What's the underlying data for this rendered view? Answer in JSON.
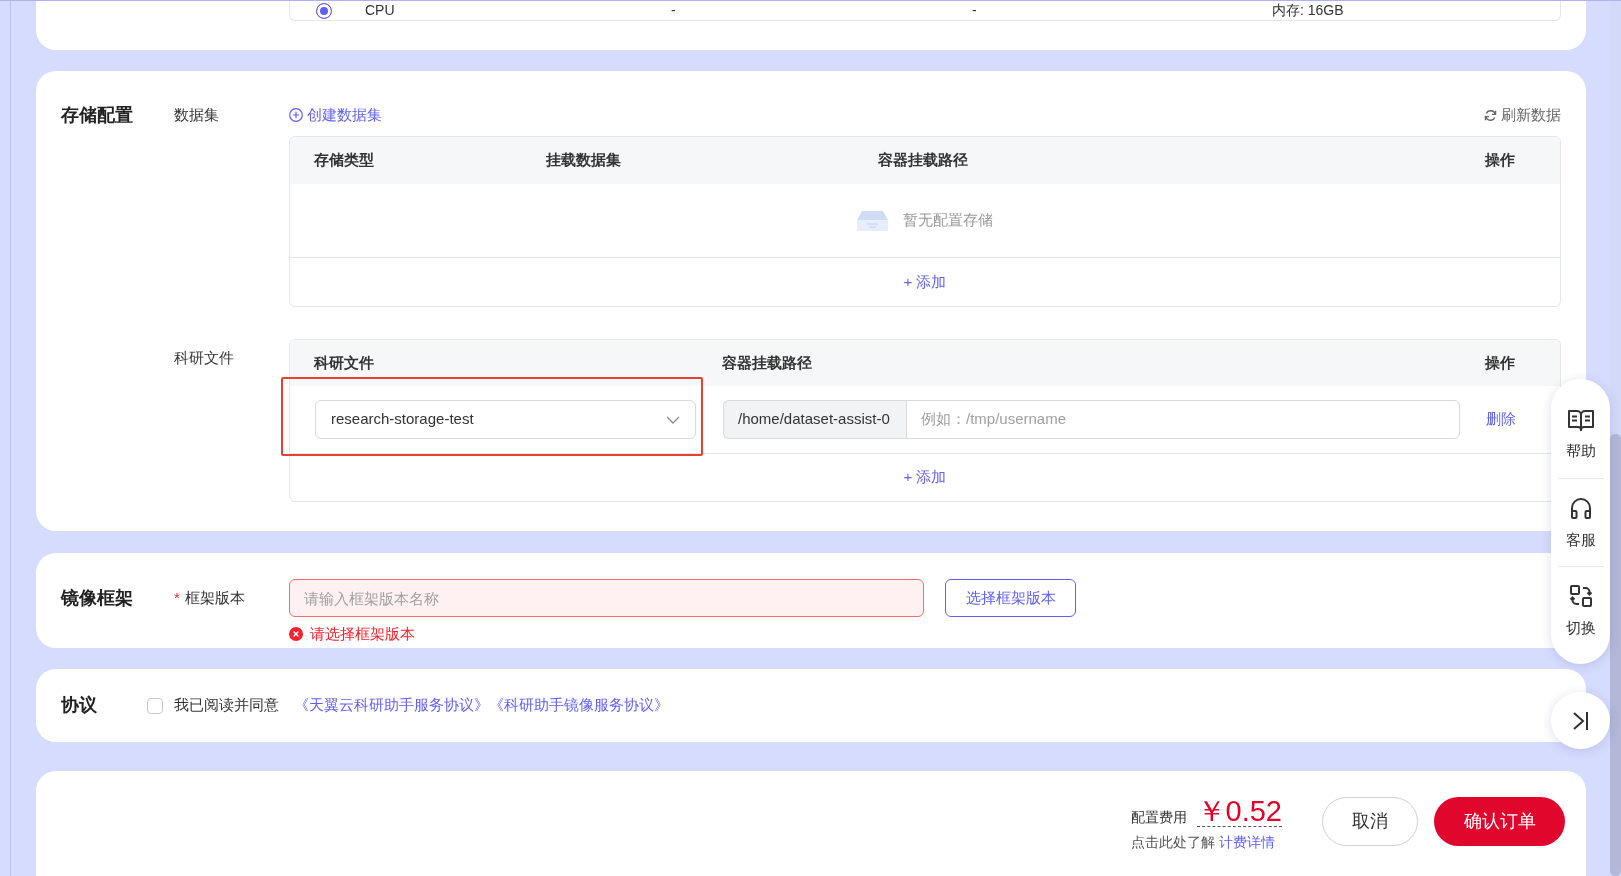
{
  "top_table": {
    "rows": [
      {
        "selected": true,
        "column_1": "CPU",
        "column_2": "-",
        "column_3": "-",
        "column_4": "内存: 16GB"
      }
    ]
  },
  "storage": {
    "title": "存储配置",
    "dataset": {
      "label": "数据集",
      "create_link": "创建数据集",
      "refresh_link": "刷新数据",
      "columns": [
        "存储类型",
        "挂载数据集",
        "容器挂载路径",
        "操作"
      ],
      "empty_text": "暂无配置存储",
      "add_link": "+ 添加"
    },
    "research_files": {
      "label": "科研文件",
      "columns": [
        "科研文件",
        "容器挂载路径",
        "操作"
      ],
      "rows": [
        {
          "file": "research-storage-test",
          "highlighted": true,
          "path_prefix": "/home/dataset-assist-0",
          "path_placeholder": "例如：/tmp/username",
          "delete_link": "删除"
        }
      ],
      "add_link": "+ 添加"
    }
  },
  "framework": {
    "title": "镜像框架",
    "field": {
      "required_mark": "*",
      "label": "框架版本",
      "placeholder": "请输入框架版本名称",
      "error": "请选择框架版本"
    },
    "select_button": "选择框架版本"
  },
  "agreement": {
    "title": "协议",
    "checked": false,
    "text": "我已阅读并同意",
    "links": [
      "《天翼云科研助手服务协议》",
      "《科研助手镜像服务协议》"
    ]
  },
  "footer": {
    "fee_label": "配置费用",
    "price": "￥0.52",
    "hint": "点击此处了解",
    "hint_link": "计费详情",
    "buttons": [
      {
        "label": "取消",
        "kind": "secondary"
      },
      {
        "label": "确认订单",
        "kind": "primary"
      }
    ]
  },
  "side_toolbar": {
    "items": [
      {
        "label": "帮助",
        "kind": "help"
      },
      {
        "label": "客服",
        "kind": "service"
      },
      {
        "label": "切换",
        "kind": "switch"
      }
    ]
  }
}
